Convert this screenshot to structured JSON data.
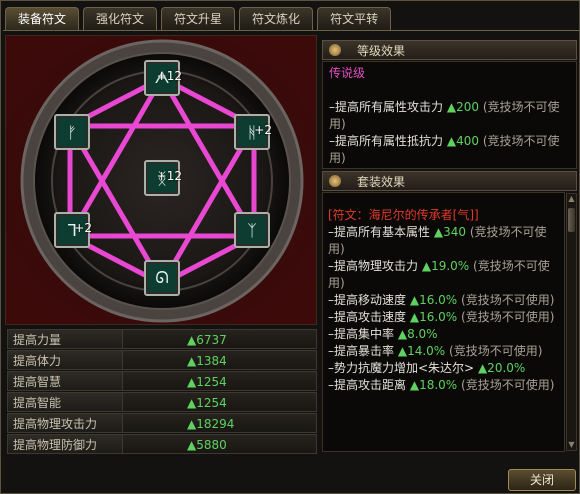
{
  "tabs": [
    "装备符文",
    "强化符文",
    "符文升星",
    "符文炼化",
    "符文平转"
  ],
  "rune_slots": [
    {
      "glyph": "ᗅ",
      "level": "+12"
    },
    {
      "glyph": "ᚻ",
      "level": "+2"
    },
    {
      "glyph": "ᛉ",
      "level": ""
    },
    {
      "glyph": "ᘏ",
      "level": ""
    },
    {
      "glyph": "ᒣ",
      "level": "+2"
    },
    {
      "glyph": "ᚠ",
      "level": ""
    },
    {
      "glyph": "ᛝ",
      "level": "+12"
    }
  ],
  "stats": [
    {
      "name": "提高力量",
      "value": "▲6737"
    },
    {
      "name": "提高体力",
      "value": "▲1384"
    },
    {
      "name": "提高智慧",
      "value": "▲1254"
    },
    {
      "name": "提高智能",
      "value": "▲1254"
    },
    {
      "name": "提高物理攻击力",
      "value": "▲18294"
    },
    {
      "name": "提高物理防御力",
      "value": "▲5880"
    }
  ],
  "level_effect": {
    "title": "等级效果",
    "grade": "传说级",
    "lines": [
      {
        "text": "–提高所有属性攻击力",
        "value": "▲200",
        "note": "(竞技场不可使用)"
      },
      {
        "text": "–提高所有属性抵抗力",
        "value": "▲400",
        "note": "(竞技场不可使用)"
      }
    ]
  },
  "set_effect": {
    "title": "套装效果",
    "set_name": "[符文：海尼尔的传承者[气]]",
    "lines": [
      {
        "text": "–提高所有基本属性",
        "value": "▲340",
        "note": "(竞技场不可使用)"
      },
      {
        "text": "–提高物理攻击力",
        "value": "▲19.0%",
        "note": "(竞技场不可使用)"
      },
      {
        "text": "–提高移动速度",
        "value": "▲16.0%",
        "note": "(竞技场不可使用)"
      },
      {
        "text": "–提高攻击速度",
        "value": "▲16.0%",
        "note": "(竞技场不可使用)"
      },
      {
        "text": "–提高集中率",
        "value": "▲8.0%",
        "note": ""
      },
      {
        "text": "–提高暴击率",
        "value": "▲14.0%",
        "note": "(竞技场不可使用)"
      },
      {
        "text": "–势力抗魔力增加<朱达尔>",
        "value": "▲20.0%",
        "note": ""
      },
      {
        "text": "–提高攻击距离",
        "value": "▲18.0%",
        "note": "(竞技场不可使用)"
      }
    ]
  },
  "close_label": "关闭"
}
